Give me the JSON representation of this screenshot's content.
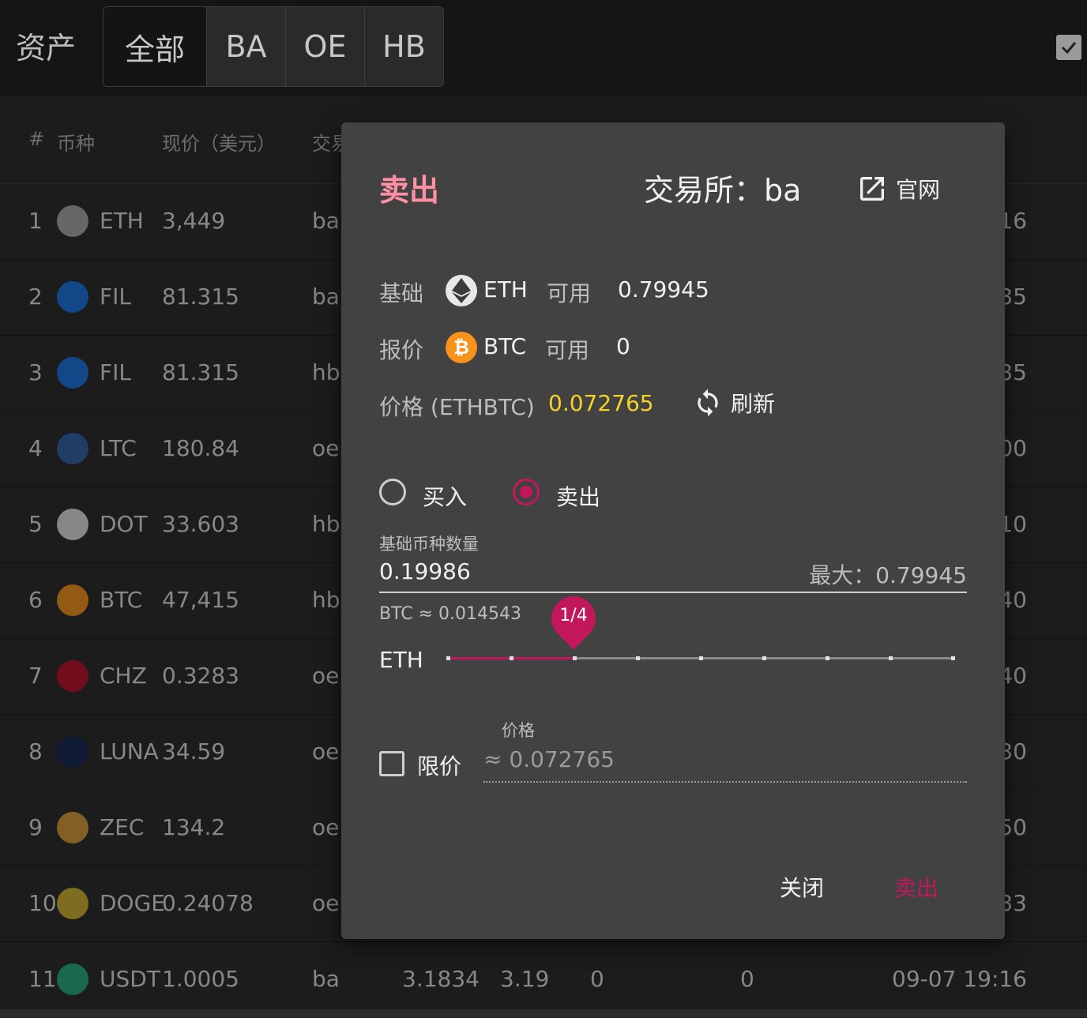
{
  "app": {
    "title": "资产",
    "tabs": [
      "全部",
      "BA",
      "OE",
      "HB"
    ]
  },
  "table": {
    "headers": {
      "index": "#",
      "coin": "币种",
      "price": "现价（美元）",
      "exchange": "交易"
    },
    "rows": [
      {
        "n": "1",
        "coin": "ETH",
        "price": "3,449",
        "ex": "ba",
        "right": "16",
        "icon": "eth-icon",
        "color": "#9e9e9e"
      },
      {
        "n": "2",
        "coin": "FIL",
        "price": "81.315",
        "ex": "ba",
        "right": "35",
        "icon": "filecoin-icon",
        "color": "#1e6fd1"
      },
      {
        "n": "3",
        "coin": "FIL",
        "price": "81.315",
        "ex": "hb",
        "right": "35",
        "icon": "filecoin-icon",
        "color": "#1e6fd1"
      },
      {
        "n": "4",
        "coin": "LTC",
        "price": "180.84",
        "ex": "oe",
        "right": "00",
        "icon": "litecoin-icon",
        "color": "#345d9d"
      },
      {
        "n": "5",
        "coin": "DOT",
        "price": "33.603",
        "ex": "hb",
        "right": "10",
        "icon": "polkadot-icon",
        "color": "#d0d0d0"
      },
      {
        "n": "6",
        "coin": "BTC",
        "price": "47,415",
        "ex": "hb",
        "right": "40",
        "icon": "bitcoin-icon",
        "color": "#e08a1e"
      },
      {
        "n": "7",
        "coin": "CHZ",
        "price": "0.3283",
        "ex": "oe",
        "right": "40",
        "icon": "chiliz-icon",
        "color": "#b0152a"
      },
      {
        "n": "8",
        "coin": "LUNA",
        "price": "34.59",
        "ex": "oe",
        "right": "30",
        "icon": "luna-icon",
        "color": "#172852"
      },
      {
        "n": "9",
        "coin": "ZEC",
        "price": "134.2",
        "ex": "oe",
        "right": "50",
        "icon": "zcash-icon",
        "color": "#c8943a"
      },
      {
        "n": "10",
        "coin": "DOGE",
        "price": "0.24078",
        "ex": "oe",
        "right": "33",
        "icon": "dogecoin-icon",
        "color": "#c2a633"
      },
      {
        "n": "11",
        "coin": "USDT",
        "price": "1.0005",
        "ex": "ba",
        "right": "09-07 19:16",
        "icon": "tether-icon",
        "color": "#26a17b",
        "extra": [
          "3.1834",
          "3.19",
          "0",
          "0"
        ]
      }
    ]
  },
  "dialog": {
    "title": "卖出",
    "exchange_label": "交易所：ba",
    "website_label": "官网",
    "base_label": "基础",
    "base_coin": "ETH",
    "available_label": "可用",
    "base_available": "0.79945",
    "quote_label": "报价",
    "quote_coin": "BTC",
    "quote_available": "0",
    "price_label": "价格 (ETHBTC)",
    "price_value": "0.072765",
    "refresh_label": "刷新",
    "buy_label": "买入",
    "sell_label": "卖出",
    "amount_label": "基础币种数量",
    "amount_value": "0.19986",
    "max_label": "最大：0.79945",
    "btc_estimate": "BTC ≈ 0.014543",
    "slider_unit": "ETH",
    "slider_value_label": "1/4",
    "slider_fraction": 0.25,
    "limit_label": "限价",
    "limit_price_label": "价格",
    "limit_price_value": "≈ 0.072765",
    "close_button": "关闭",
    "sell_button": "卖出",
    "accent": "#c2185b",
    "title_color": "#ff8fa3",
    "price_color": "#f5d327"
  }
}
